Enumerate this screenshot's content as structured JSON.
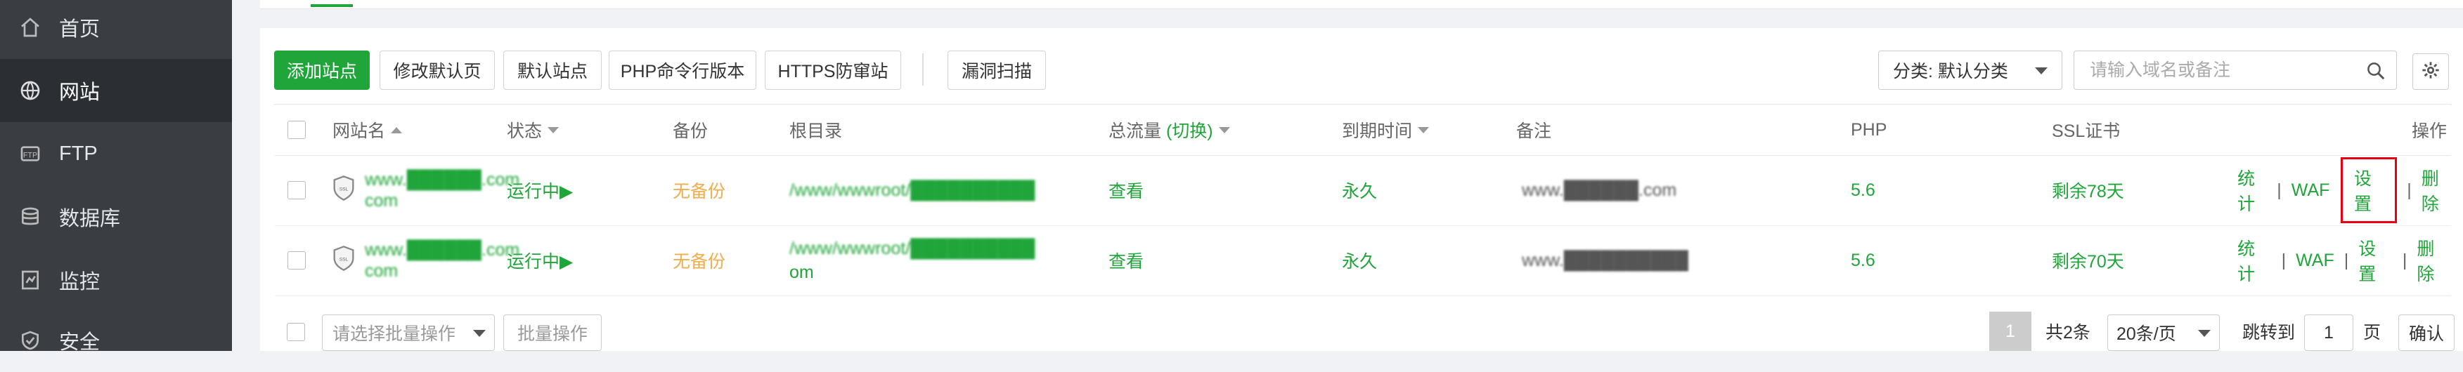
{
  "sidebar": {
    "items": [
      {
        "label": "首页",
        "icon": "home-icon"
      },
      {
        "label": "网站",
        "icon": "globe-icon"
      },
      {
        "label": "FTP",
        "icon": "ftp-icon"
      },
      {
        "label": "数据库",
        "icon": "database-icon"
      },
      {
        "label": "监控",
        "icon": "monitor-icon"
      },
      {
        "label": "安全",
        "icon": "shield-icon"
      }
    ]
  },
  "toolbar": {
    "add_site": "添加站点",
    "edit_default_page": "修改默认页",
    "default_site": "默认站点",
    "php_cli_version": "PHP命令行版本",
    "https_guard": "HTTPS防窜站",
    "vuln_scan": "漏洞扫描",
    "category_select": "分类: 默认分类",
    "search_placeholder": "请输入域名或备注"
  },
  "table": {
    "headers": {
      "site_name": "网站名",
      "status": "状态",
      "backup": "备份",
      "root": "根目录",
      "traffic": "总流量",
      "traffic_toggle": "(切换)",
      "expiry": "到期时间",
      "remark": "备注",
      "php": "PHP",
      "ssl": "SSL证书",
      "actions": "操作"
    },
    "rows": [
      {
        "name_line1": "www.██████.com",
        "name_line2": "com",
        "status": "运行中▶",
        "backup": "无备份",
        "root": "/www/wwwroot/██████████",
        "traffic": "查看",
        "expiry": "永久",
        "remark": "www.██████.com",
        "php": "5.6",
        "ssl": "剩余78天",
        "act_stats": "统计",
        "act_waf": "WAF",
        "act_settings": "设置",
        "act_delete": "删除"
      },
      {
        "name_line1": "www.██████.com",
        "name_line2": "com",
        "status": "运行中▶",
        "backup": "无备份",
        "root": "/www/wwwroot/██████████",
        "root_line2": "om",
        "traffic": "查看",
        "expiry": "永久",
        "remark": "www.██████████",
        "php": "5.6",
        "ssl": "剩余70天",
        "act_stats": "统计",
        "act_waf": "WAF",
        "act_settings": "设置",
        "act_delete": "删除"
      }
    ]
  },
  "footer": {
    "batch_placeholder": "请选择批量操作",
    "batch_button": "批量操作",
    "current_page": "1",
    "total": "共2条",
    "per_page": "20条/页",
    "jump_to": "跳转到",
    "jump_value": "1",
    "page_unit": "页",
    "confirm": "确认"
  },
  "colors": {
    "sidebar_bg": "#3a3d41",
    "sidebar_active": "#2b2e32",
    "accent_green": "#20a53a",
    "warning_orange": "#f0ad4e",
    "highlight_red": "#e60012"
  }
}
